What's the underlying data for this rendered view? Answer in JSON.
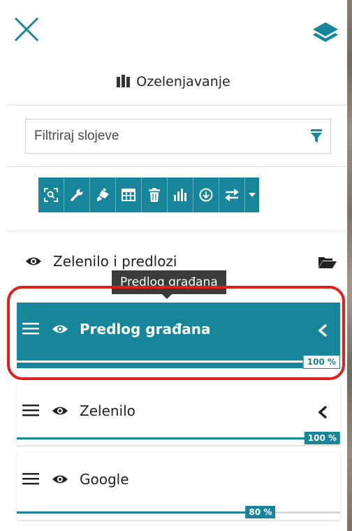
{
  "header": {
    "title": "Ozelenjavanje"
  },
  "filter": {
    "placeholder": "Filtriraj slojeve"
  },
  "toolbar": {
    "buttons": [
      "zoom-to-layer-icon",
      "settings-wrench-icon",
      "style-brush-icon",
      "attribute-table-icon",
      "delete-icon",
      "chart-icon",
      "download-icon",
      "swap-icon",
      "caret-down-icon"
    ]
  },
  "group": {
    "label": "Zelenilo i predlozi"
  },
  "tooltip": {
    "text": "Predlog građana"
  },
  "layers": [
    {
      "name": "Predlog građana",
      "opacity": 100,
      "opacity_label": "100 %",
      "selected": true
    },
    {
      "name": "Zelenilo",
      "opacity": 100,
      "opacity_label": "100 %",
      "selected": false
    },
    {
      "name": "Google",
      "opacity": 80,
      "opacity_label": "80 %",
      "selected": false
    }
  ],
  "colors": {
    "accent": "#17859a",
    "highlight": "#e0201b",
    "tooltip": "#3b3b3b"
  }
}
